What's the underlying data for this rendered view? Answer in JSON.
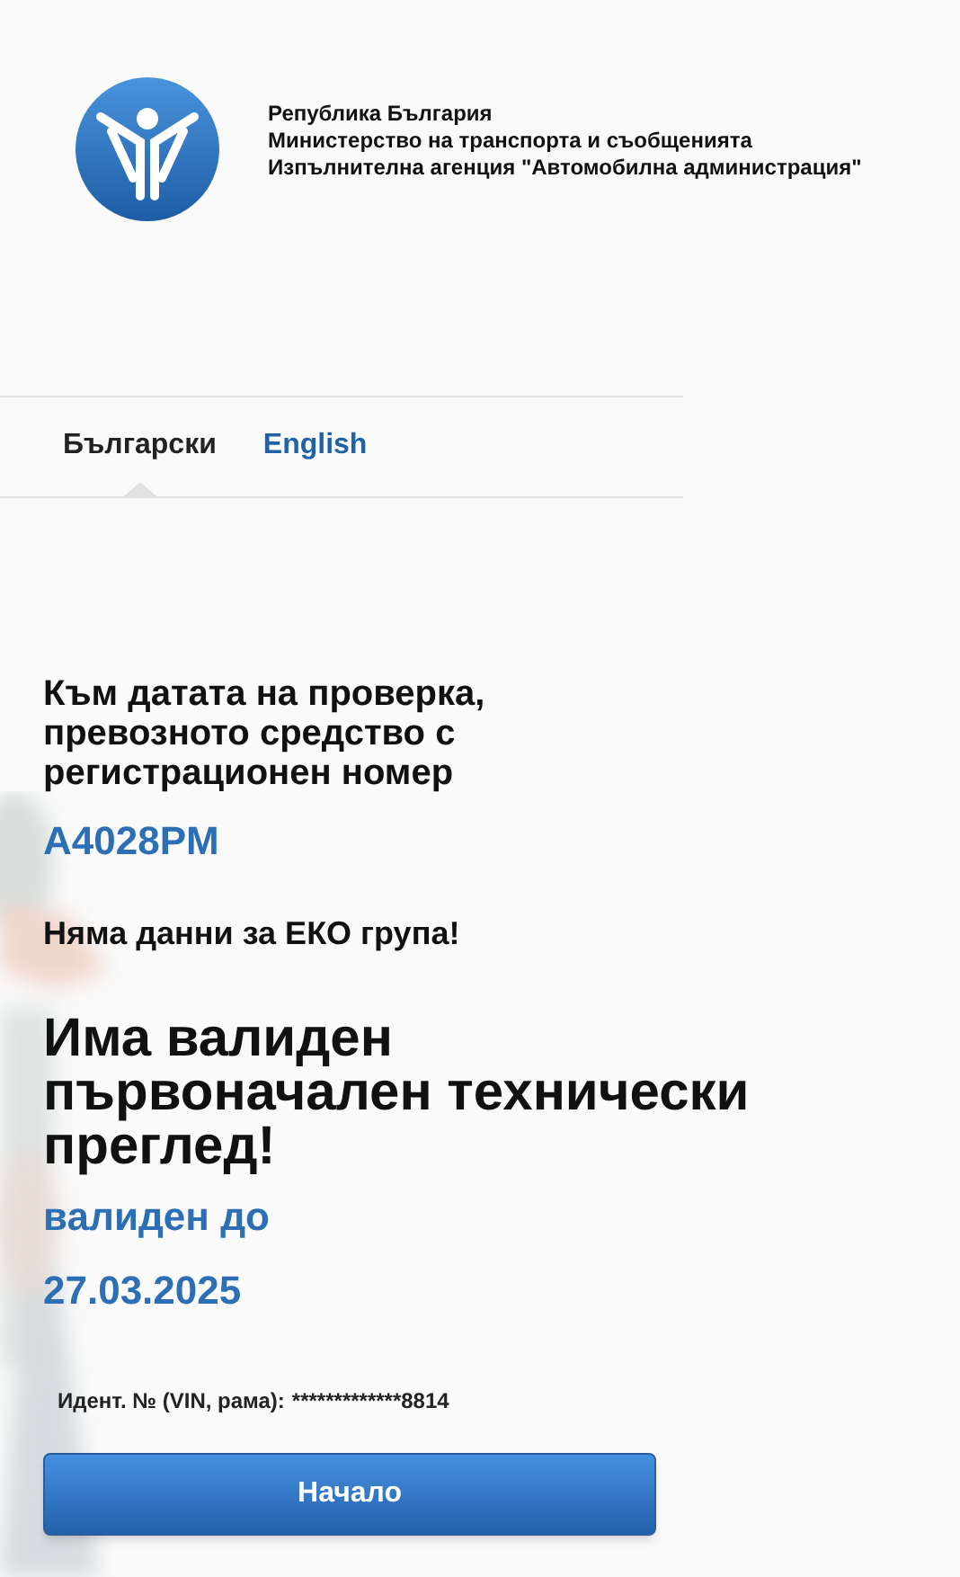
{
  "header": {
    "lines": [
      "Република България",
      "Министерство на транспорта и съобщенията",
      "Изпълнителна агенция \"Автомобилна администрация\""
    ]
  },
  "language_tabs": [
    {
      "label": "Български",
      "selected": true
    },
    {
      "label": "English",
      "selected": false
    }
  ],
  "result": {
    "intro": "Към датата на проверка, превозното средство с регистрационен номер",
    "plate": "A4028PM",
    "eco_note": "Няма данни за ЕКО група!",
    "headline": "Има валиден първоначален технически преглед!",
    "valid_label": "валиден до",
    "valid_date": "27.03.2025",
    "vin_label": "Идент. № (VIN, рама):",
    "vin_value": "*************8814"
  },
  "button": {
    "label": "Начало"
  }
}
